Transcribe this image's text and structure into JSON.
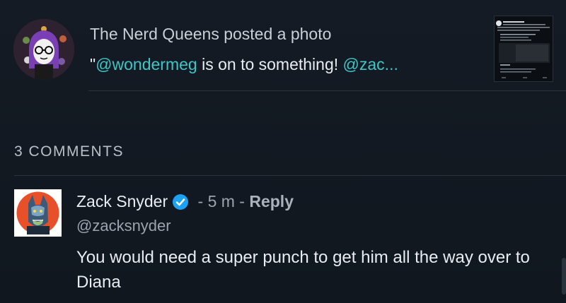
{
  "post": {
    "title": "The Nerd Queens posted a photo",
    "quote_prefix": "\"",
    "quote_mention": "@wondermeg",
    "quote_middle": " is on to something!  ",
    "quote_mention2": "@zac...",
    "avatar_icon": "nerd-queens-avatar",
    "thumbnail_icon": "tweet-screenshot-thumbnail"
  },
  "comments_header": {
    "label": "3 COMMENTS"
  },
  "comment": {
    "author": "Zack Snyder",
    "verified_icon": "verified-check-icon",
    "separator1": " - ",
    "time": "5 m",
    "separator2": " - ",
    "reply_label": "Reply",
    "handle": "@zacksnyder",
    "text": "You would need a super punch to get him all the way over to Diana",
    "avatar_icon": "zack-snyder-avatar"
  },
  "colors": {
    "background": "#141b24",
    "mention": "#3cc6c7",
    "verified": "#1da1f2",
    "divider": "#2b333c"
  }
}
